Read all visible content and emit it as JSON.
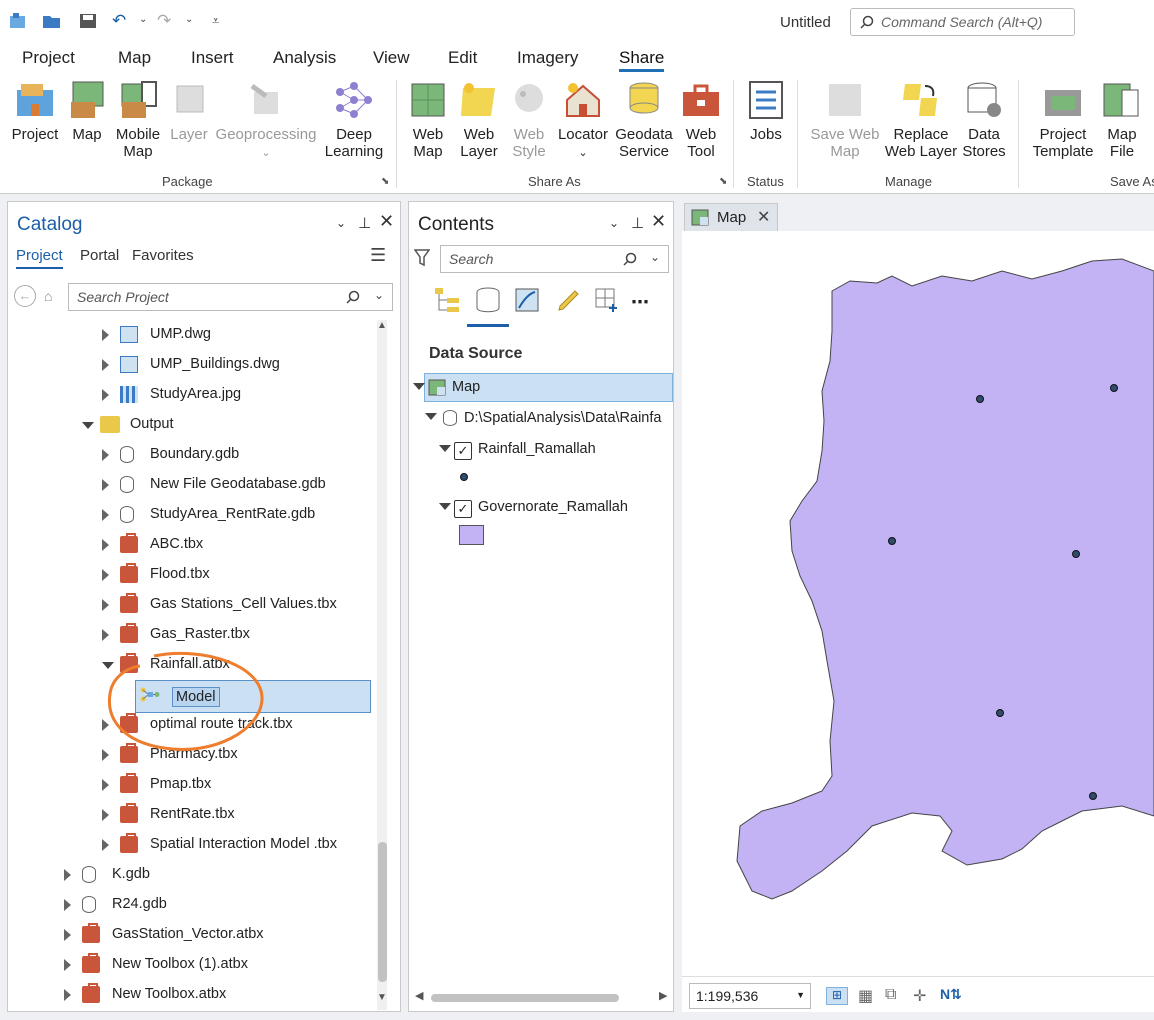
{
  "app": {
    "title": "Untitled",
    "command_search_placeholder": "Command Search (Alt+Q)"
  },
  "tabs": [
    "Project",
    "Map",
    "Insert",
    "Analysis",
    "View",
    "Edit",
    "Imagery",
    "Share"
  ],
  "active_tab": "Share",
  "ribbon": {
    "package": {
      "label": "Package",
      "buttons": [
        "Project",
        "Map",
        "Mobile Map",
        "Layer",
        "Geoprocessing",
        "Deep Learning"
      ]
    },
    "share_as": {
      "label": "Share As",
      "buttons": [
        "Web Map",
        "Web Layer",
        "Web Style",
        "Locator",
        "Geodata Service",
        "Web Tool"
      ]
    },
    "status": {
      "label": "Status",
      "buttons": [
        "Jobs"
      ]
    },
    "manage": {
      "label": "Manage",
      "buttons": [
        "Save Web Map",
        "Replace Web Layer",
        "Data Stores"
      ]
    },
    "save_as": {
      "label": "Save As",
      "buttons": [
        "Project Template",
        "Map File"
      ]
    }
  },
  "catalog": {
    "title": "Catalog",
    "tabs": [
      "Project",
      "Portal",
      "Favorites"
    ],
    "search_placeholder": "Search Project",
    "items": [
      {
        "label": "UMP.dwg",
        "type": "cad"
      },
      {
        "label": "UMP_Buildings.dwg",
        "type": "cad"
      },
      {
        "label": "StudyArea.jpg",
        "type": "raster"
      },
      {
        "label": "Output",
        "type": "folder"
      },
      {
        "label": "Boundary.gdb",
        "type": "gdb"
      },
      {
        "label": "New File Geodatabase.gdb",
        "type": "gdb"
      },
      {
        "label": "StudyArea_RentRate.gdb",
        "type": "gdb"
      },
      {
        "label": "ABC.tbx",
        "type": "tbx"
      },
      {
        "label": "Flood.tbx",
        "type": "tbx"
      },
      {
        "label": "Gas Stations_Cell Values.tbx",
        "type": "tbx"
      },
      {
        "label": "Gas_Raster.tbx",
        "type": "tbx"
      },
      {
        "label": "Rainfall.atbx",
        "type": "tbx"
      },
      {
        "label": "Model",
        "type": "model"
      },
      {
        "label": "optimal route track.tbx",
        "type": "tbx"
      },
      {
        "label": "Pharmacy.tbx",
        "type": "tbx"
      },
      {
        "label": "Pmap.tbx",
        "type": "tbx"
      },
      {
        "label": "RentRate.tbx",
        "type": "tbx"
      },
      {
        "label": "Spatial Interaction Model .tbx",
        "type": "tbx"
      },
      {
        "label": "K.gdb",
        "type": "gdb"
      },
      {
        "label": "R24.gdb",
        "type": "gdb"
      },
      {
        "label": "GasStation_Vector.atbx",
        "type": "tbx"
      },
      {
        "label": "New Toolbox (1).atbx",
        "type": "tbx"
      },
      {
        "label": "New Toolbox.atbx",
        "type": "tbx"
      }
    ]
  },
  "contents": {
    "title": "Contents",
    "search_placeholder": "Search",
    "heading": "Data Source",
    "map_label": "Map",
    "source_path": "D:\\SpatialAnalysis\\Data\\Rainfa",
    "layers": [
      "Rainfall_Ramallah",
      "Governorate_Ramallah"
    ]
  },
  "map": {
    "tab_label": "Map",
    "scale": "1:199,536",
    "fill_color": "#c3b3f5"
  },
  "colors": {
    "accent": "#1c5fa8",
    "selection": "#cce0f4",
    "annotation": "#ee7d2e"
  }
}
